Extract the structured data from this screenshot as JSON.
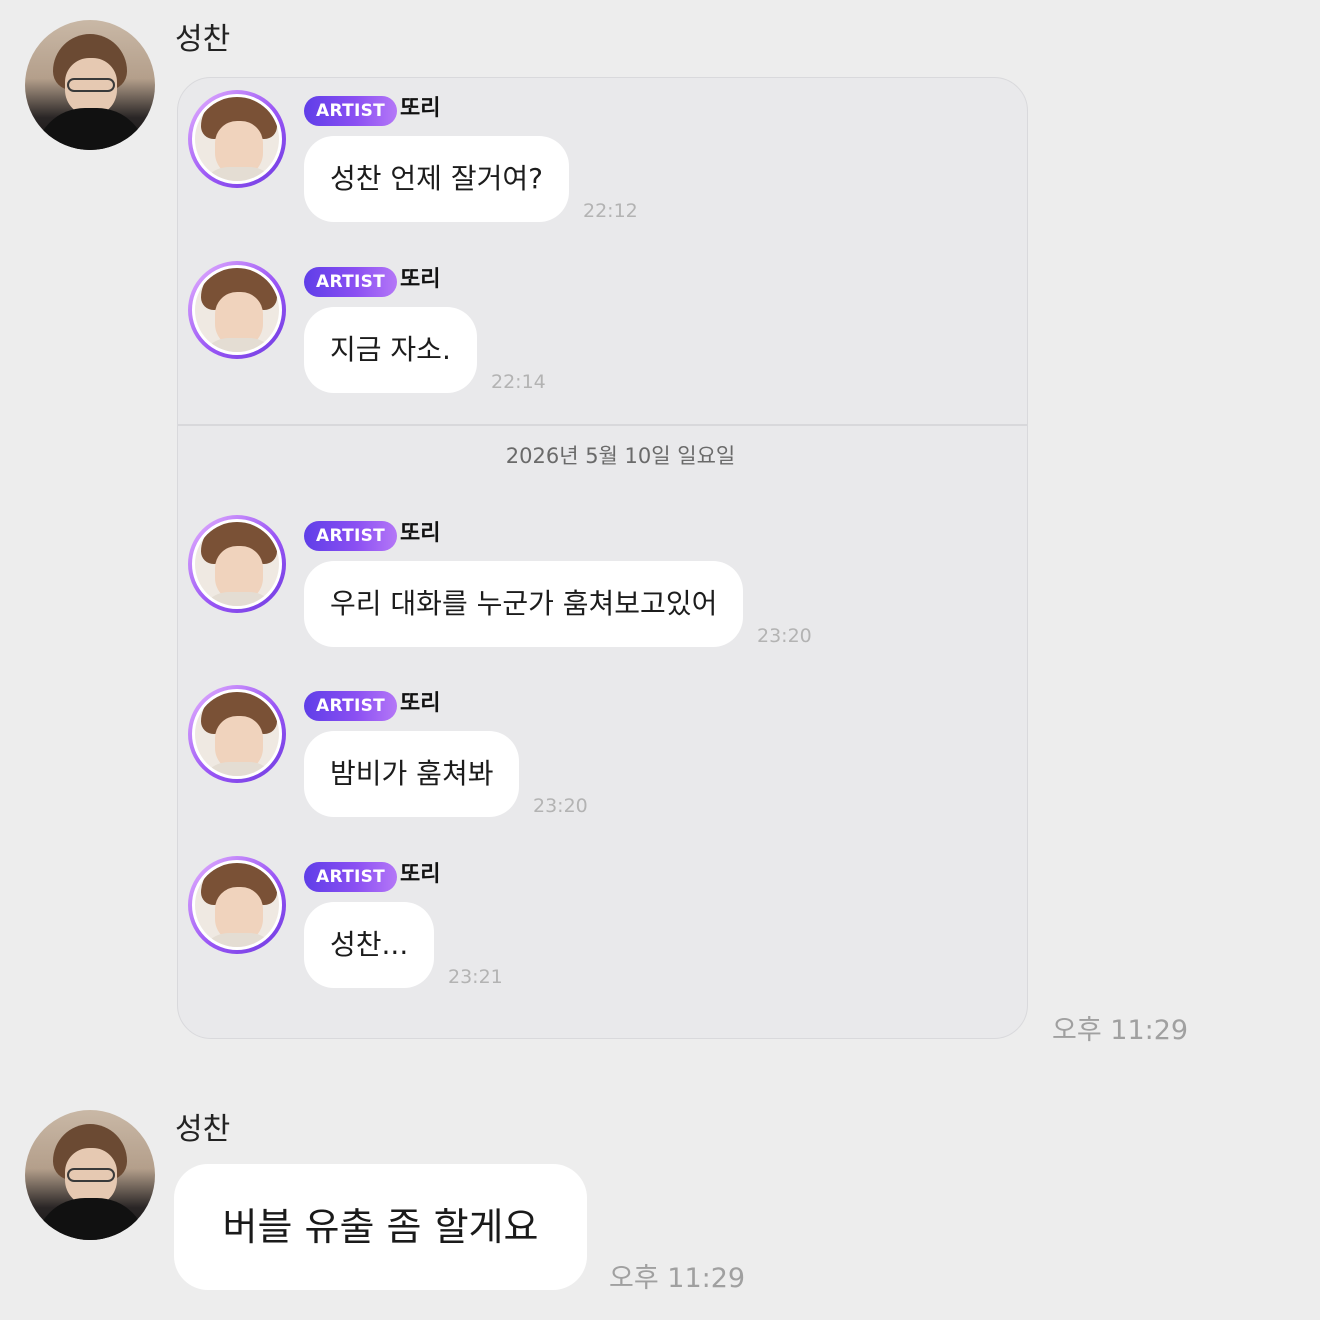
{
  "chat": {
    "first": {
      "sender": "성찬",
      "time": "오후 11:29"
    },
    "shared_card": {
      "date_divider": "2026년 5월 10일 일요일",
      "messages": [
        {
          "badge": "ARTIST",
          "sender": "또리",
          "text": "성찬 언제 잘거여?",
          "time": "22:12"
        },
        {
          "badge": "ARTIST",
          "sender": "또리",
          "text": "지금 자소.",
          "time": "22:14"
        },
        {
          "badge": "ARTIST",
          "sender": "또리",
          "text": "우리 대화를 누군가 훔쳐보고있어",
          "time": "23:20"
        },
        {
          "badge": "ARTIST",
          "sender": "또리",
          "text": "밤비가 훔쳐봐",
          "time": "23:20"
        },
        {
          "badge": "ARTIST",
          "sender": "또리",
          "text": "성찬...",
          "time": "23:21"
        }
      ]
    },
    "second": {
      "sender": "성찬",
      "text": "버블 유출 좀 할게요",
      "time": "오후 11:29"
    }
  },
  "colors": {
    "background": "#ededed",
    "card": "#e9e9eb",
    "bubble": "#ffffff",
    "artist_badge": "#7a48f0"
  }
}
